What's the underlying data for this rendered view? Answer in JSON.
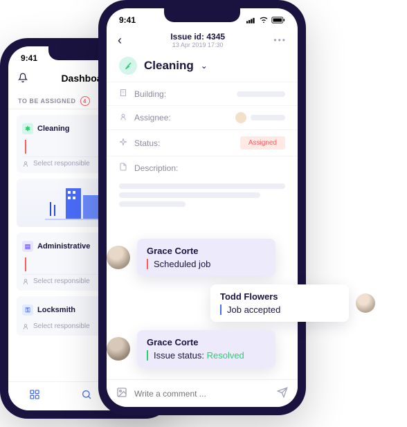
{
  "status_time": "9:41",
  "back_phone": {
    "title": "Dashboard",
    "section": "TO BE ASSIGNED",
    "count": "4",
    "cards": [
      "Cleaning",
      "Administrative",
      "Locksmith"
    ],
    "select_responsible": "Select responsible"
  },
  "front_phone": {
    "issue_title": "Issue id: 4345",
    "issue_date": "13 Apr 2019 17:30",
    "category": "Cleaning",
    "labels": {
      "building": "Building:",
      "assignee": "Assignee:",
      "status": "Status:",
      "description": "Description:"
    },
    "status_value": "Assigned",
    "comment_placeholder": "Write a comment ..."
  },
  "chat": [
    {
      "name": "Grace Corte",
      "body": "Scheduled job",
      "accent": "orange",
      "bubble": "lav",
      "avatar_bg": "#d8c8b8"
    },
    {
      "name": "Todd Flowers",
      "body": "Job accepted",
      "accent": "blue",
      "bubble": "white",
      "reply": true,
      "avatar_bg": "#e8d8c8"
    },
    {
      "name": "Grace Corte",
      "body_prefix": "Issue status: ",
      "body_status": "Resolved",
      "accent": "green",
      "bubble": "lav",
      "avatar_bg": "#c8b8a8"
    }
  ]
}
